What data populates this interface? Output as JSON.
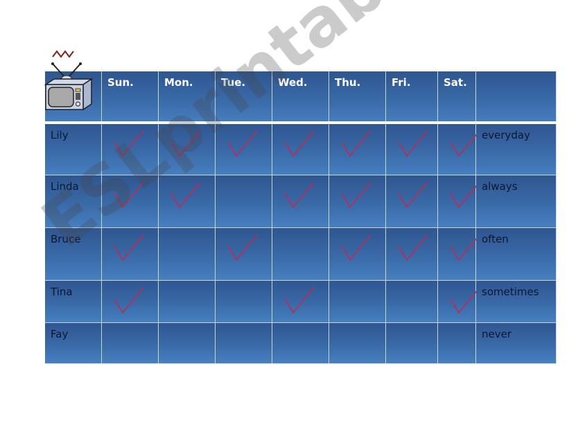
{
  "header": {
    "days": [
      "Sun.",
      "Mon.",
      "Tue.",
      "Wed.",
      "Thu.",
      "Fri.",
      "Sat."
    ],
    "corner_icon": "tv-icon",
    "last_column_label": ""
  },
  "rows": [
    {
      "name": "Lily",
      "frequency": "everyday",
      "checks": [
        true,
        true,
        true,
        true,
        true,
        true,
        true
      ]
    },
    {
      "name": "Linda",
      "frequency": "always",
      "checks": [
        true,
        true,
        false,
        true,
        true,
        true,
        true
      ]
    },
    {
      "name": "Bruce",
      "frequency": "often",
      "checks": [
        true,
        false,
        true,
        false,
        true,
        true,
        true
      ]
    },
    {
      "name": "Tina",
      "frequency": "sometimes",
      "checks": [
        true,
        false,
        false,
        true,
        false,
        false,
        true
      ]
    },
    {
      "name": "Fay",
      "frequency": "never",
      "checks": [
        false,
        false,
        false,
        false,
        false,
        false,
        false
      ]
    }
  ],
  "watermark": "ESLprintables.com",
  "colors": {
    "check": "#b0305a",
    "header_text": "#ffffff",
    "cell_text": "#0b1630"
  }
}
